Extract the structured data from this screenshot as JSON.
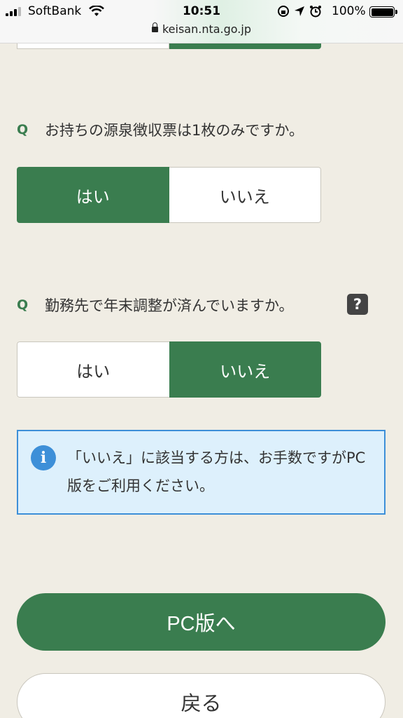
{
  "status_bar": {
    "carrier": "SoftBank",
    "time": "10:51",
    "battery": "100%",
    "url": "keisan.nta.go.jp"
  },
  "questions": [
    {
      "marker": "Q",
      "text": "お持ちの源泉徴収票は1枚のみですか。",
      "options": [
        "はい",
        "いいえ"
      ],
      "selected": "はい"
    },
    {
      "marker": "Q",
      "text": "勤務先で年末調整が済んでいますか。",
      "help": "?",
      "options": [
        "はい",
        "いいえ"
      ],
      "selected": "いいえ"
    }
  ],
  "info": {
    "icon": "info-icon",
    "text": "「いいえ」に該当する方は、お手数ですがPC版をご利用ください。"
  },
  "buttons": {
    "pc_version": "PC版へ",
    "back": "戻る"
  },
  "colors": {
    "accent_green": "#3a7d4f",
    "info_blue": "#3d8fd8",
    "info_bg": "#ddf0fc",
    "page_bg": "#f0ede4"
  }
}
